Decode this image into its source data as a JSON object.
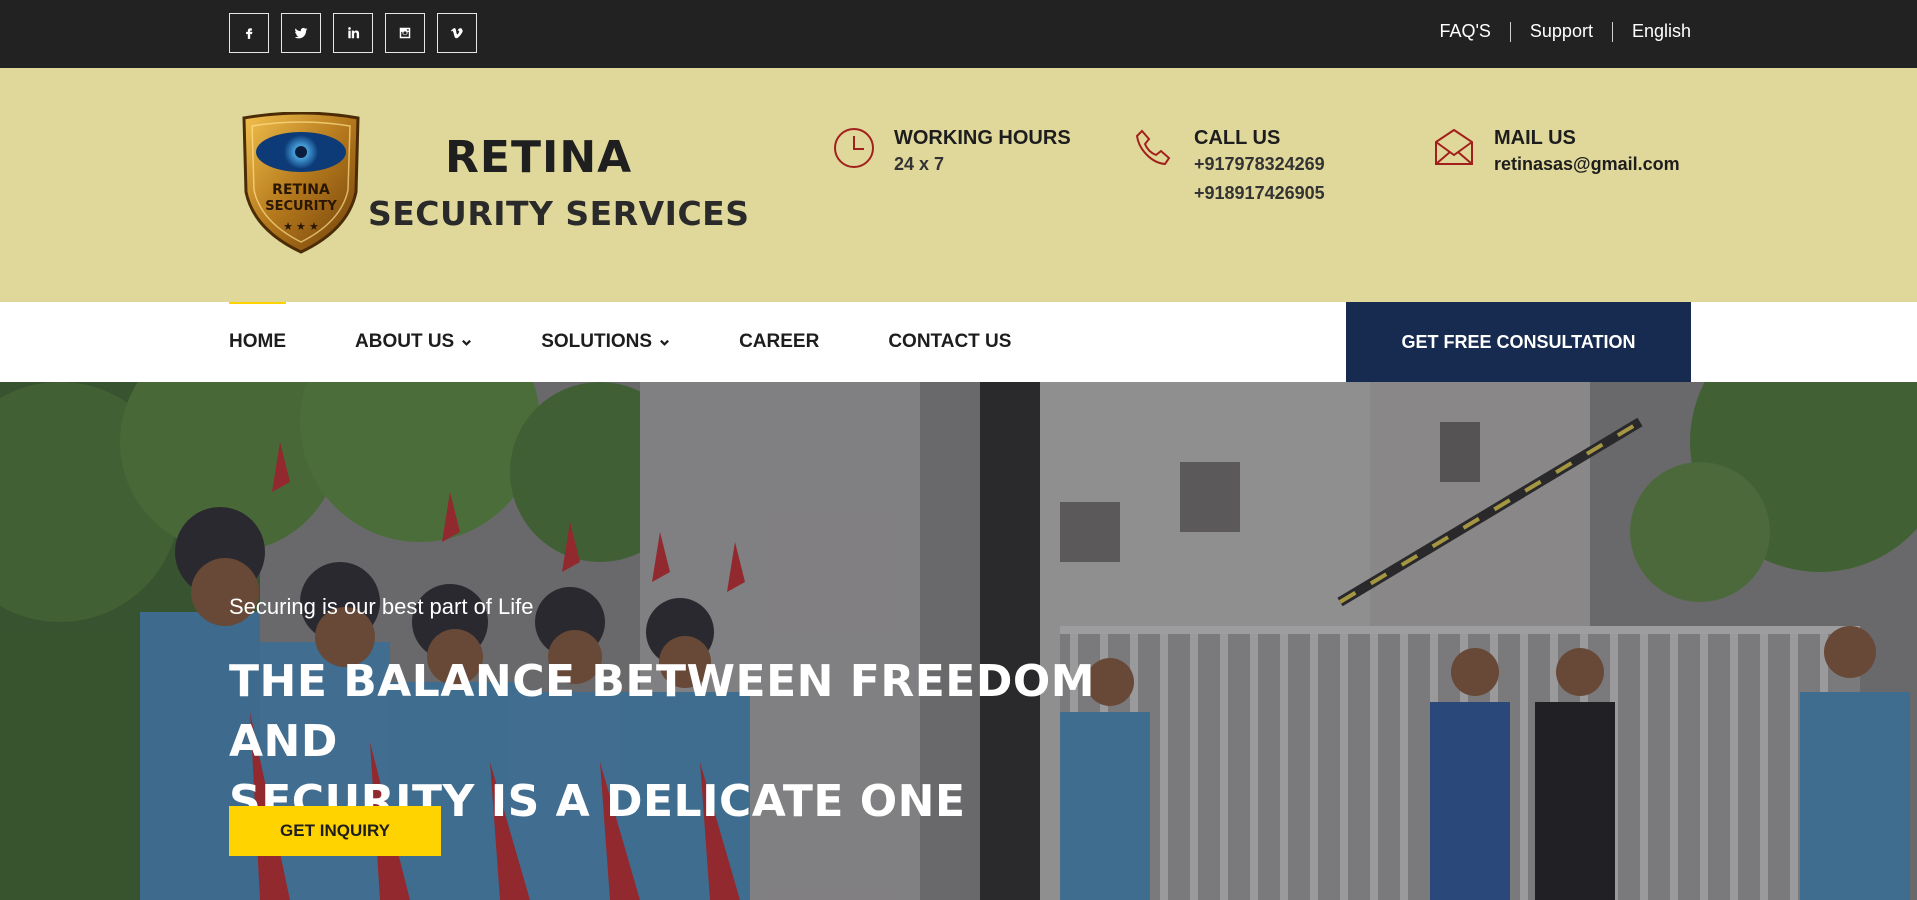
{
  "topbar": {
    "social": [
      {
        "icon": "facebook-icon",
        "glyph": "f"
      },
      {
        "icon": "twitter-icon",
        "glyph": "t"
      },
      {
        "icon": "linkedin-icon",
        "glyph": "in"
      },
      {
        "icon": "instagram-icon",
        "glyph": "ig"
      },
      {
        "icon": "vimeo-icon",
        "glyph": "v"
      }
    ],
    "links": [
      "FAQ'S",
      "Support",
      "English"
    ]
  },
  "brand": {
    "name_line1": "RETINA",
    "name_line2": "SECURITY SERVICES",
    "badge_line1": "RETINA",
    "badge_line2": "SECURITY"
  },
  "info": {
    "hours": {
      "title": "WORKING HOURS",
      "value": "24 x 7",
      "icon": "clock-icon"
    },
    "call": {
      "title": "CALL US",
      "phone1": "+917978324269",
      "phone2": "+918917426905",
      "icon": "phone-icon"
    },
    "mail": {
      "title": "MAIL US",
      "email": "retinasas@gmail.com",
      "icon": "envelope-icon"
    }
  },
  "nav": {
    "items": [
      "HOME",
      "ABOUT US",
      "SOLUTIONS",
      "CAREER",
      "CONTACT US"
    ],
    "cta": "GET FREE CONSULTATION"
  },
  "hero": {
    "subtitle": "Securing is our best part of Life",
    "title_line1": "THE BALANCE BETWEEN FREEDOM AND",
    "title_line2": "SECURITY IS A DELICATE ONE",
    "button": "GET INQUIRY"
  },
  "colors": {
    "topbar": "#222222",
    "header": "#e0d89b",
    "accent": "#ffd300",
    "cta": "#172a4f",
    "icon": "#a2201c"
  }
}
